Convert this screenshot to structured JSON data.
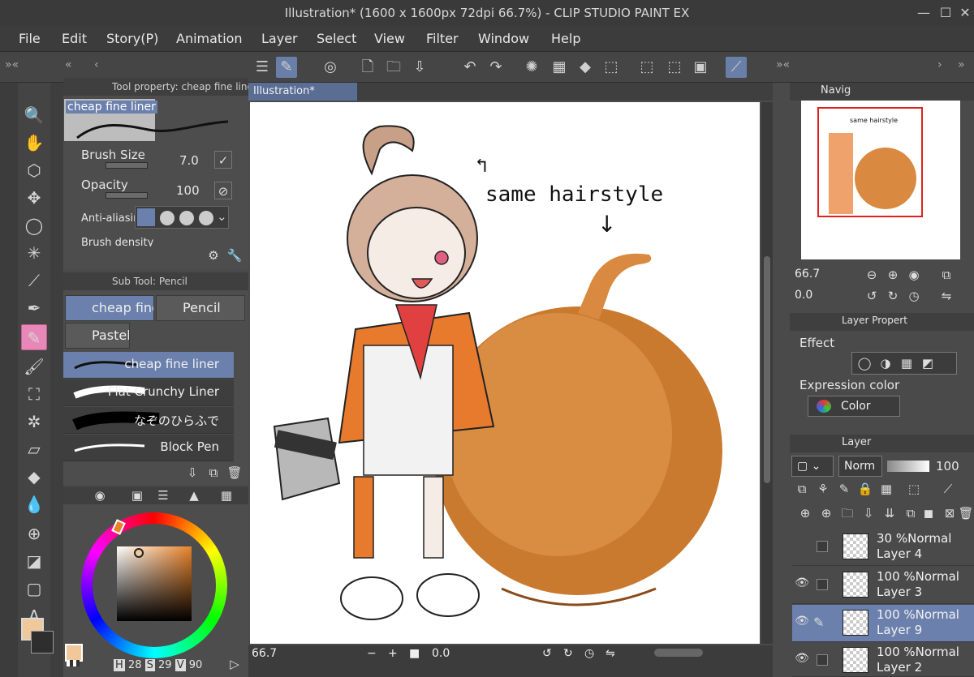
{
  "window": {
    "title": "Illustration* (1600 x 1600px 72dpi 66.7%) - CLIP STUDIO PAINT EX"
  },
  "menu": [
    "File",
    "Edit",
    "Story(P)",
    "Animation",
    "Layer",
    "Select",
    "View",
    "Filter",
    "Window",
    "Help"
  ],
  "tool_property": {
    "header": "Tool property: cheap fine liner",
    "preset_name": "cheap fine liner",
    "brush_size_label": "Brush Size",
    "brush_size_value": "7.0",
    "opacity_label": "Opacity",
    "opacity_value": "100",
    "antialias_label": "Anti-aliasin",
    "density_label": "Brush density"
  },
  "sub_tool": {
    "header": "Sub Tool: Pencil",
    "tabs": [
      "cheap fine",
      "Pencil",
      "Pastel"
    ],
    "brushes": [
      "cheap fine liner",
      "Flat Crunchy Liner",
      "なぞのひらふで",
      "Block Pen"
    ]
  },
  "color": {
    "main_swatch": "#f0c89a",
    "sub_swatch": "#f0c89a",
    "h": "28",
    "s": "29",
    "v": "90",
    "h_label": "H",
    "s_label": "S",
    "v_label": "V"
  },
  "document": {
    "tab": "Illustration*",
    "zoom": "66.7",
    "rotation": "0.0"
  },
  "canvas_text": {
    "annotation": "same hairstyle",
    "arrow_up": "↰",
    "arrow_down": "↓"
  },
  "navigator": {
    "tab": "Navig",
    "zoom": "66.7",
    "rotation": "0.0",
    "annotation": "same hairstyle"
  },
  "layer_property": {
    "tab": "Layer Propert",
    "effect_label": "Effect",
    "expression_label": "Expression color",
    "expression_value": "Color"
  },
  "layers": {
    "tab": "Layer",
    "blend_mode": "Norm",
    "opacity": "100",
    "items": [
      {
        "pct": "30 %",
        "mode": "Normal",
        "name": "Layer 4",
        "visible": false,
        "active": false
      },
      {
        "pct": "100 %",
        "mode": "Normal",
        "name": "Layer 3",
        "visible": true,
        "active": false
      },
      {
        "pct": "100 %",
        "mode": "Normal",
        "name": "Layer 9",
        "visible": true,
        "active": true
      },
      {
        "pct": "100 %",
        "mode": "Normal",
        "name": "Layer 2",
        "visible": true,
        "active": false
      }
    ]
  }
}
